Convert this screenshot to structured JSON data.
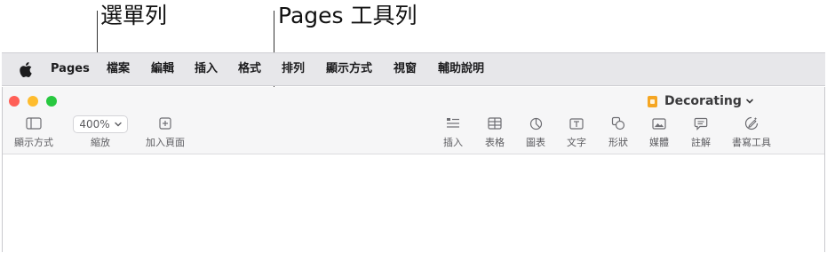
{
  "callouts": {
    "menubar": "選單列",
    "toolbar": "Pages 工具列"
  },
  "menubar": {
    "app": "Pages",
    "items": [
      "檔案",
      "編輯",
      "插入",
      "格式",
      "排列",
      "顯示方式",
      "視窗",
      "輔助說明"
    ]
  },
  "window": {
    "document_title": "Decorating",
    "traffic_colors": {
      "close": "#ff5f57",
      "minimize": "#febc2e",
      "zoom": "#28c840"
    }
  },
  "toolbar": {
    "view_label": "顯示方式",
    "zoom_value": "400%",
    "zoom_label": "縮放",
    "add_page_label": "加入頁面",
    "insert_label": "插入",
    "table_label": "表格",
    "chart_label": "圖表",
    "text_label": "文字",
    "shape_label": "形狀",
    "media_label": "媒體",
    "comment_label": "註解",
    "writing_tools_label": "書寫工具"
  }
}
